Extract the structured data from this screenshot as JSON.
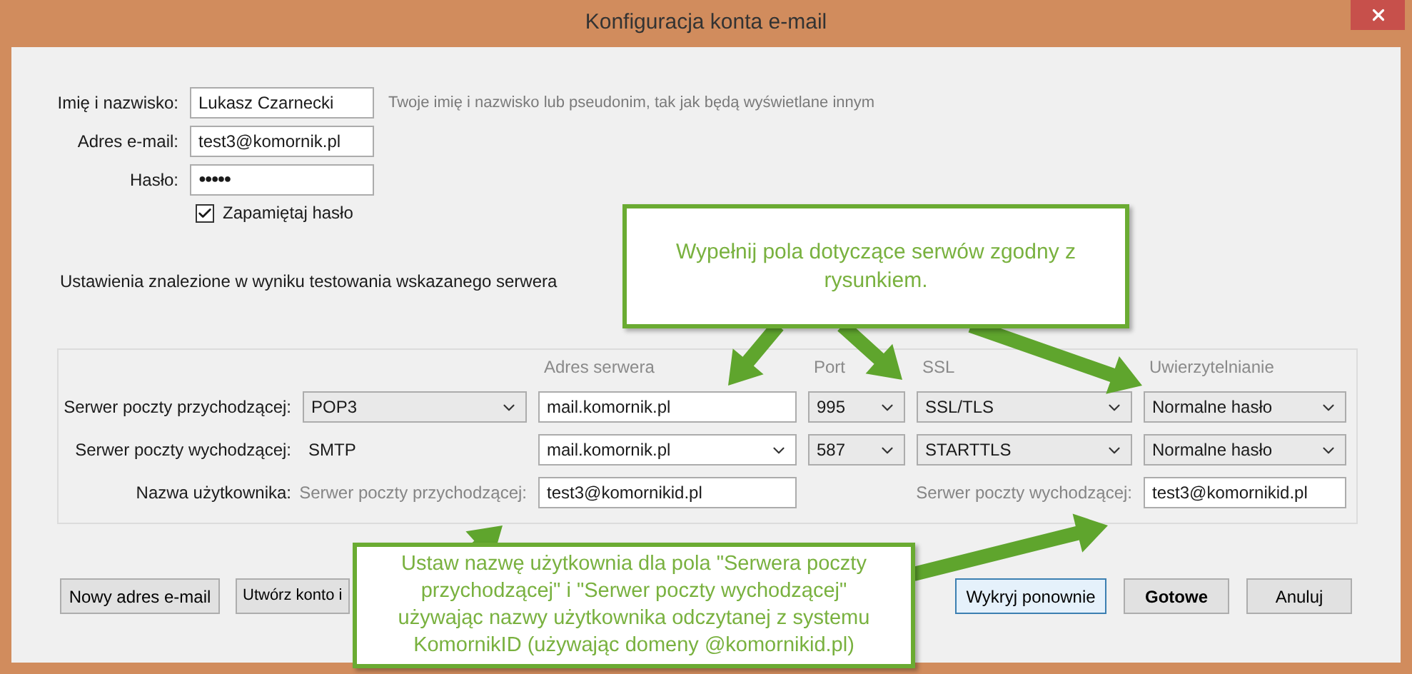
{
  "window": {
    "title": "Konfiguracja konta e-mail"
  },
  "identity": {
    "fields": [
      {
        "label": "Imię i nazwisko:",
        "value": "Lukasz Czarnecki",
        "kind": "text"
      },
      {
        "label": "Adres e-mail:",
        "value": "test3@komornik.pl",
        "kind": "text"
      },
      {
        "label": "Hasło:",
        "value": "●●●●●",
        "kind": "password"
      }
    ],
    "hint": "Twoje imię i nazwisko lub pseudonim, tak jak będą wyświetlane innym",
    "remember": {
      "label": "Zapamiętaj hasło",
      "checked": true
    }
  },
  "status_text": "Ustawienia znalezione w wyniku testowania wskazanego serwera",
  "server_settings": {
    "columns": [
      "Adres serwera",
      "Port",
      "SSL",
      "Uwierzytelnianie"
    ],
    "rows": [
      {
        "label": "Serwer poczty przychodzącej:",
        "protocol": {
          "kind": "select",
          "value": "POP3"
        },
        "cells": [
          {
            "kind": "input",
            "value": "mail.komornik.pl"
          },
          {
            "kind": "select",
            "value": "995"
          },
          {
            "kind": "select",
            "value": "SSL/TLS"
          },
          {
            "kind": "select",
            "value": "Normalne hasło"
          }
        ]
      },
      {
        "label": "Serwer poczty wychodzącej:",
        "protocol": {
          "kind": "text",
          "value": "SMTP"
        },
        "cells": [
          {
            "kind": "combo",
            "value": "mail.komornik.pl"
          },
          {
            "kind": "select",
            "value": "587"
          },
          {
            "kind": "select",
            "value": "STARTTLS"
          },
          {
            "kind": "select",
            "value": "Normalne hasło"
          }
        ]
      }
    ],
    "username": {
      "label": "Nazwa użytkownika:",
      "incoming_label": "Serwer poczty przychodzącej:",
      "incoming_value": "test3@komornikid.pl",
      "outgoing_label": "Serwer poczty wychodzącej:",
      "outgoing_value": "test3@komornikid.pl"
    }
  },
  "buttons_left": [
    {
      "label": "Nowy adres e-mail",
      "default": false,
      "focused": false
    },
    {
      "label": "Utwórz konto i",
      "default": false,
      "focused": false
    }
  ],
  "buttons_right": [
    {
      "label": "Wykryj ponownie",
      "default": false,
      "focused": true
    },
    {
      "label": "Gotowe",
      "default": true,
      "focused": false
    },
    {
      "label": "Anuluj",
      "default": false,
      "focused": false
    }
  ],
  "callouts": [
    {
      "text": "Wypełnij pola dotyczące serwów zgodny z rysunkiem."
    },
    {
      "text": "Ustaw nazwę użytkownia dla pola \"Serwera poczty przychodzącej\" i \"Serwer poczty wychodzącej\" używając nazwy użytkownika odczytanej z systemu KomornikID (używając domeny @komornikid.pl)"
    }
  ]
}
